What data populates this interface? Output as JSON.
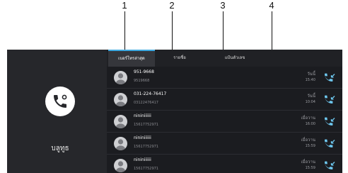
{
  "callouts": [
    "1",
    "2",
    "3",
    "4"
  ],
  "left_panel": {
    "icon": "phone-icon",
    "label": "บลูทูธ"
  },
  "tabs": [
    {
      "label": "เบอร์โทรล่าสุด",
      "active": true
    },
    {
      "label": "รายชื่อ",
      "active": false
    },
    {
      "label": "แป้นตัวเลข",
      "active": false
    }
  ],
  "calls": [
    {
      "name": "951-9668",
      "number": "9519668",
      "day": "วันนี้",
      "time": "15:40"
    },
    {
      "name": "031-224-76417",
      "number": "03122476417",
      "day": "วันนี้",
      "time": "10:04"
    },
    {
      "name": "nininiiiiii",
      "number": "15617752971",
      "day": "เมื่อวาน",
      "time": "16:00"
    },
    {
      "name": "nininiiiiii",
      "number": "15617752971",
      "day": "เมื่อวาน",
      "time": "15:59"
    },
    {
      "name": "nininiiiiii",
      "number": "15617752971",
      "day": "เมื่อวาน",
      "time": "15:59"
    }
  ],
  "colors": {
    "accent": "#3da8e0",
    "dial_icon": "#6ec8f0",
    "background": "#1b1c20"
  }
}
